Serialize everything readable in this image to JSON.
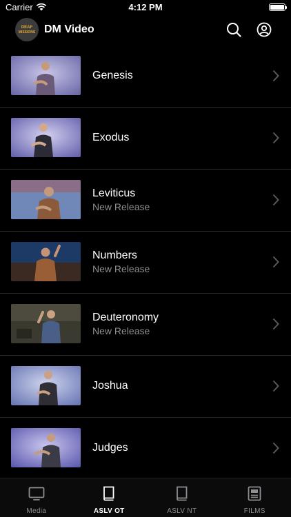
{
  "status_bar": {
    "carrier": "Carrier",
    "time": "4:12 PM"
  },
  "header": {
    "app_title": "DM Video",
    "logo_text_1": "DEAF",
    "logo_text_2": "MISSIONS"
  },
  "list": [
    {
      "title": "Genesis",
      "subtitle": ""
    },
    {
      "title": "Exodus",
      "subtitle": ""
    },
    {
      "title": "Leviticus",
      "subtitle": "New Release"
    },
    {
      "title": "Numbers",
      "subtitle": "New Release"
    },
    {
      "title": "Deuteronomy",
      "subtitle": "New Release"
    },
    {
      "title": "Joshua",
      "subtitle": ""
    },
    {
      "title": "Judges",
      "subtitle": ""
    }
  ],
  "tabs": [
    {
      "label": "Media",
      "icon": "tv-icon",
      "active": false
    },
    {
      "label": "ASLV OT",
      "icon": "book-icon",
      "active": true
    },
    {
      "label": "ASLV NT",
      "icon": "book-icon",
      "active": false
    },
    {
      "label": "FILMS",
      "icon": "film-icon",
      "active": false
    }
  ],
  "colors": {
    "background": "#000000",
    "secondary_text": "#8e8e93",
    "divider": "#2a2a2a"
  }
}
